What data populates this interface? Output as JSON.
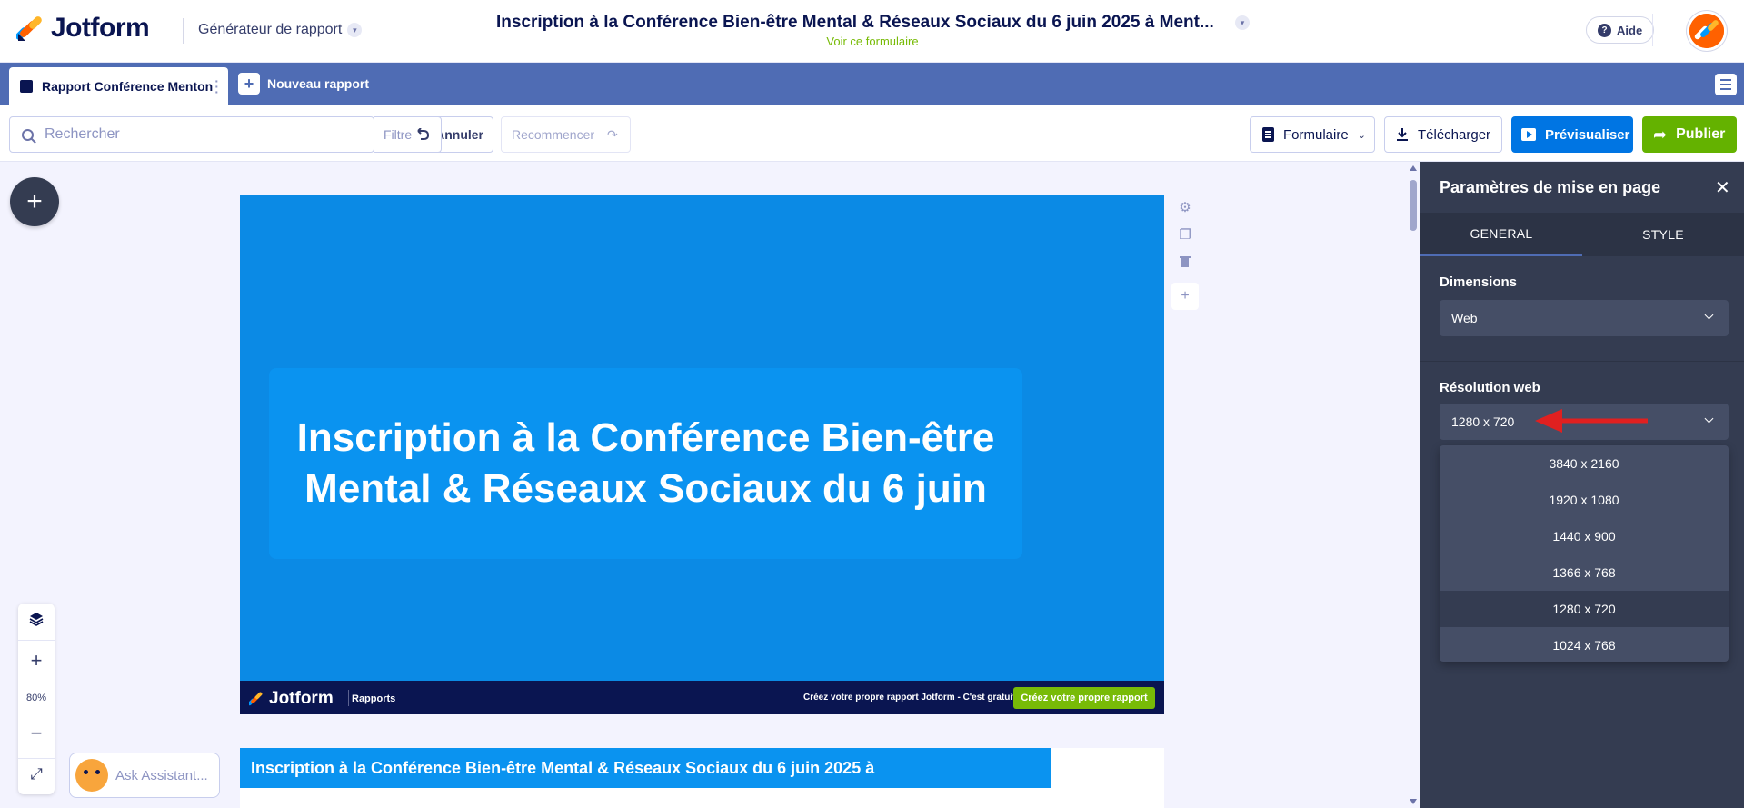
{
  "header": {
    "logo_text": "Jotform",
    "generator_label": "Générateur de rapport",
    "form_title": "Inscription à la Conférence Bien-être Mental & Réseaux Sociaux du 6 juin 2025 à Ment...",
    "view_form_link": "Voir ce formulaire",
    "help_label": "Aide"
  },
  "tabs": {
    "active_tab": "Rapport Conférence Menton",
    "new_report": "Nouveau rapport"
  },
  "toolbar": {
    "search_placeholder": "Rechercher",
    "filter_label": "Filtre",
    "undo_label": "Annuler",
    "redo_label": "Recommencer",
    "form_label": "Formulaire",
    "download_label": "Télécharger",
    "preview_label": "Prévisualiser",
    "publish_label": "Publier"
  },
  "canvas": {
    "slide_title": "Inscription à la Conférence Bien-être Mental & Réseaux Sociaux du 6 juin",
    "footer_logo": "Jotform",
    "footer_reports": "Rapports",
    "footer_promo": "Créez votre propre rapport Jotform - C'est gratuit",
    "footer_cta": "Créez votre propre rapport",
    "slide2_title": "Inscription à la Conférence Bien-être Mental & Réseaux Sociaux du 6 juin 2025 à",
    "zoom_level": "80%",
    "ask_assistant": "Ask Assistant..."
  },
  "panel": {
    "title": "Paramètres de mise en page",
    "tab_general": "GENERAL",
    "tab_style": "STYLE",
    "dimensions_label": "Dimensions",
    "dimensions_value": "Web",
    "resolution_label": "Résolution web",
    "resolution_value": "1280 x 720",
    "resolution_options": [
      "3840 x 2160",
      "1920 x 1080",
      "1440 x 900",
      "1366 x 768",
      "1280 x 720",
      "1024 x 768"
    ],
    "selected_option_index": 4
  },
  "colors": {
    "brand_blue": "#0075e3",
    "publish_green": "#64b200",
    "tabbar": "#4f6cb4",
    "panel_bg": "#343c51",
    "slide_bg": "#0b8ae5",
    "annotation_arrow": "#e02020"
  }
}
